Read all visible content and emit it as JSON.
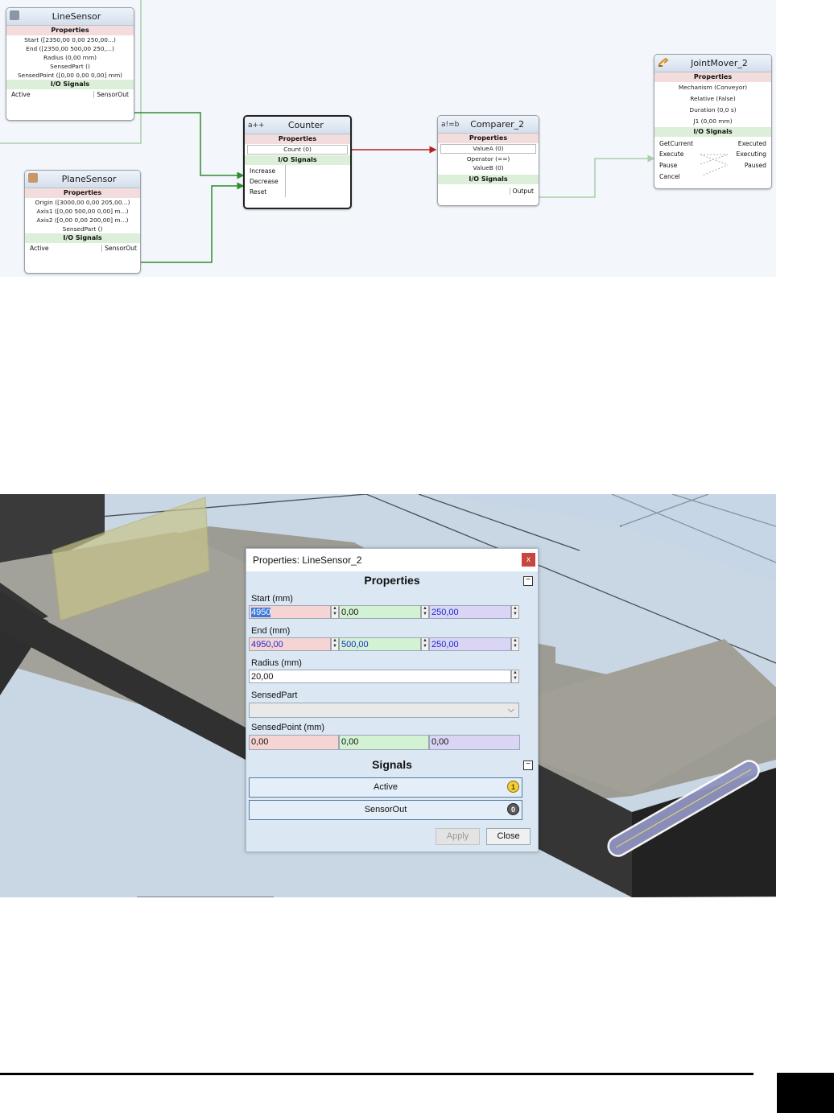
{
  "diagram": {
    "line_sensor": {
      "title": "LineSensor",
      "properties_label": "Properties",
      "props": [
        "Start ([2350,00 0,00 250,00...)",
        "End ([2350,00 500,00 250,...)",
        "Radius (0,00 mm)",
        "SensedPart ()",
        "SensedPoint ([0,00 0,00 0,00] mm)"
      ],
      "io_label": "I/O Signals",
      "in_signal": "Active",
      "out_signal": "SensorOut"
    },
    "plane_sensor": {
      "title": "PlaneSensor",
      "properties_label": "Properties",
      "props": [
        "Origin ([3000,00 0,00 205,00...)",
        "Axis1 ([0,00 500,00 0,00] m...)",
        "Axis2 ([0,00 0,00 200,00] m...)",
        "SensedPart ()"
      ],
      "io_label": "I/O Signals",
      "in_signal": "Active",
      "out_signal": "SensorOut"
    },
    "counter": {
      "icon_text": "a++",
      "title": "Counter",
      "properties_label": "Properties",
      "props": [
        "Count (0)"
      ],
      "io_label": "I/O Signals",
      "inputs": [
        "Increase",
        "Decrease",
        "Reset"
      ]
    },
    "comparer": {
      "icon_text": "a!=b",
      "title": "Comparer_2",
      "properties_label": "Properties",
      "props": [
        "ValueA (0)",
        "Operator (==)",
        "ValueB (0)"
      ],
      "io_label": "I/O Signals",
      "out_signal": "Output"
    },
    "joint_mover": {
      "title": "JointMover_2",
      "properties_label": "Properties",
      "props": [
        "Mechanism (Conveyor)",
        "Relative (False)",
        "Duration (0,0 s)",
        "J1 (0,00 mm)"
      ],
      "io_label": "I/O Signals",
      "inputs": [
        "GetCurrent",
        "Execute",
        "Pause",
        "Cancel"
      ],
      "outputs": [
        "Executed",
        "Executing",
        "Paused"
      ]
    },
    "colors": {
      "signal_link": "#2e8b2e",
      "property_link": "#b22222",
      "inactive_link": "#a9cfa9"
    }
  },
  "dialog": {
    "title": "Properties: LineSensor_2",
    "close_glyph": "x",
    "properties_header": "Properties",
    "start_label": "Start (mm)",
    "start": [
      "4950",
      "0,00",
      "250,00"
    ],
    "end_label": "End (mm)",
    "end": [
      "4950,00",
      "500,00",
      "250,00"
    ],
    "radius_label": "Radius (mm)",
    "radius": "20,00",
    "sensed_part_label": "SensedPart",
    "sensed_part": "",
    "sensed_point_label": "SensedPoint (mm)",
    "sensed_point": [
      "0,00",
      "0,00",
      "0,00"
    ],
    "signals_header": "Signals",
    "signals": [
      {
        "name": "Active",
        "value": "1"
      },
      {
        "name": "SensorOut",
        "value": "0"
      }
    ],
    "apply_label": "Apply",
    "close_label": "Close"
  }
}
